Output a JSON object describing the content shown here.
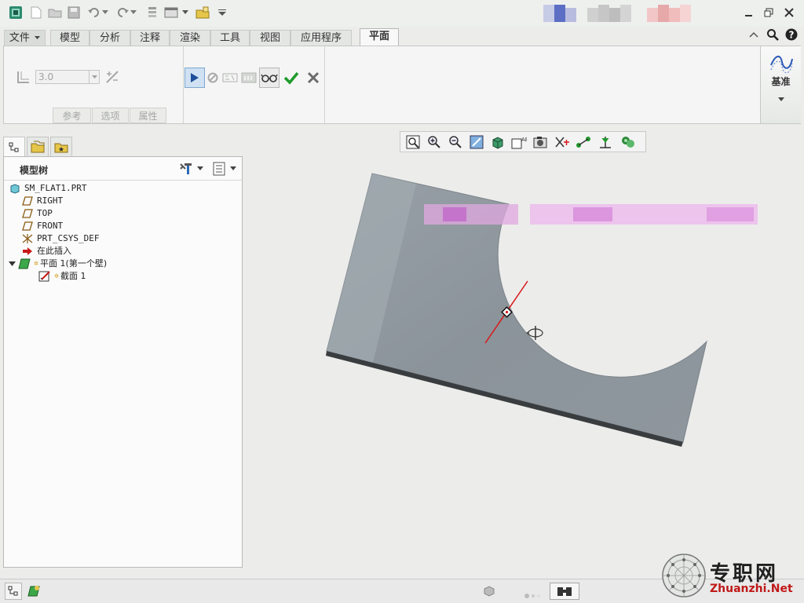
{
  "ribbon_tabs": {
    "file": "文件",
    "model": "模型",
    "analysis": "分析",
    "annotate": "注释",
    "render": "渲染",
    "tools": "工具",
    "view": "视图",
    "applications": "应用程序",
    "flat": "平面"
  },
  "ribbon": {
    "thickness_value": "3.0",
    "subtabs": {
      "references": "参考",
      "options": "选项",
      "properties": "属性"
    },
    "datum_label": "基准"
  },
  "model_tree": {
    "title": "模型树",
    "items": [
      {
        "label": "SM_FLAT1.PRT",
        "icon": "part-icon"
      },
      {
        "label": "RIGHT",
        "icon": "datum-plane-icon"
      },
      {
        "label": "TOP",
        "icon": "datum-plane-icon"
      },
      {
        "label": "FRONT",
        "icon": "datum-plane-icon"
      },
      {
        "label": "PRT_CSYS_DEF",
        "icon": "csys-icon"
      },
      {
        "label": "在此插入",
        "icon": "insert-here-arrow-icon"
      },
      {
        "label": "平面 1(第一个壁)",
        "icon": "flat-wall-icon"
      },
      {
        "label": "截面 1",
        "icon": "sketch-icon"
      }
    ]
  },
  "watermark": {
    "cn": "专职网",
    "en": "Zhuanzhi.Net"
  },
  "colors": {
    "ribbon_bg": "#f4f5f4",
    "part_face": "#8e979d",
    "part_edge": "#3a3d3f",
    "accent_red": "#d81818",
    "confirm_green": "#1e9a2a"
  }
}
